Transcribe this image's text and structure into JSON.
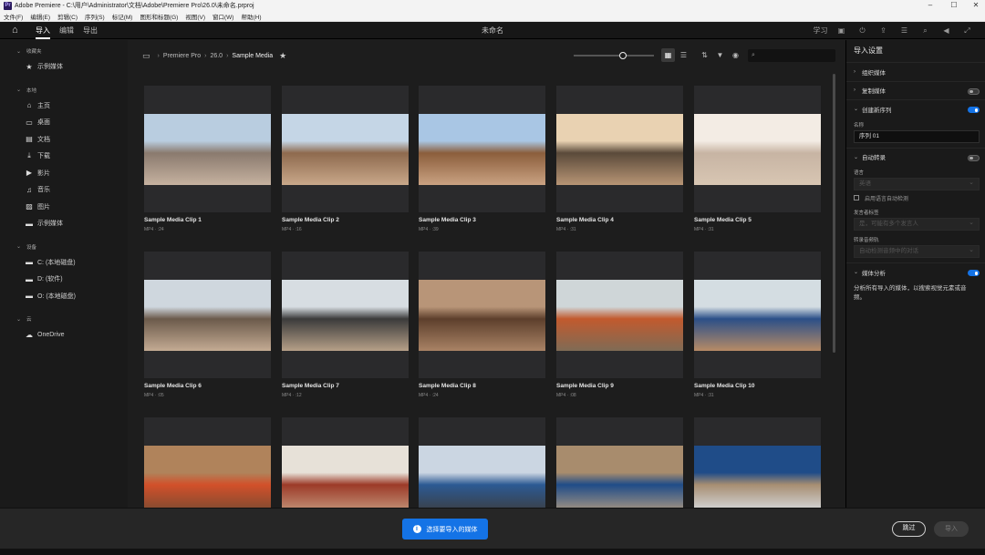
{
  "window": {
    "title": "Adobe Premiere - C:\\用户\\Administrator\\文档\\Adobe\\Premiere Pro\\26.0\\未命名.prproj",
    "icon_label": "Pr",
    "controls": [
      "–",
      "☐",
      "✕"
    ]
  },
  "menubar": [
    "文件(F)",
    "编辑(E)",
    "剪辑(C)",
    "序列(S)",
    "标记(M)",
    "图形和标题(G)",
    "视图(V)",
    "窗口(W)",
    "帮助(H)"
  ],
  "topnav": {
    "tabs": [
      "导入",
      "编辑",
      "导出"
    ],
    "active_tab": 0,
    "doc_title": "未命名",
    "right_icons": [
      "学习",
      "workspace-icon",
      "share-icon",
      "quick-export-icon",
      "panels-icon",
      "search-icon",
      "volume-icon",
      "fullscreen-icon"
    ],
    "learn_label": "学习"
  },
  "sidebar": {
    "sections": [
      {
        "title": "收藏夹",
        "items": [
          {
            "icon": "★",
            "label": "示例媒体"
          }
        ]
      },
      {
        "title": "本地",
        "items": [
          {
            "icon": "⌂",
            "label": "主页"
          },
          {
            "icon": "▭",
            "label": "桌面"
          },
          {
            "icon": "▤",
            "label": "文档"
          },
          {
            "icon": "⤓",
            "label": "下载"
          },
          {
            "icon": "▶",
            "label": "影片"
          },
          {
            "icon": "♫",
            "label": "音乐"
          },
          {
            "icon": "▨",
            "label": "图片"
          },
          {
            "icon": "▬",
            "label": "示例媒体"
          }
        ]
      },
      {
        "title": "设备",
        "items": [
          {
            "icon": "▬",
            "label": "C: (本地磁盘)"
          },
          {
            "icon": "▬",
            "label": "D: (软件)"
          },
          {
            "icon": "▬",
            "label": "O: (本地磁盘)"
          }
        ]
      },
      {
        "title": "云",
        "items": [
          {
            "icon": "☁",
            "label": "OneDrive"
          }
        ]
      }
    ]
  },
  "browser": {
    "breadcrumb": [
      "Premiere Pro",
      "26.0",
      "Sample Media"
    ],
    "search_placeholder": "",
    "zoom_level": 0.62,
    "clips": [
      {
        "name": "Sample Media Clip 1",
        "meta": "MP4 · :24",
        "colors": [
          "#b9cde0",
          "#8a7a6e",
          "#c6b2a0"
        ]
      },
      {
        "name": "Sample Media Clip 2",
        "meta": "MP4 · :16",
        "colors": [
          "#c5d6e6",
          "#8e6a4e",
          "#c9a88a"
        ]
      },
      {
        "name": "Sample Media Clip 3",
        "meta": "MP4 · :39",
        "colors": [
          "#a9c6e4",
          "#8b5e3c",
          "#caa282"
        ]
      },
      {
        "name": "Sample Media Clip 4",
        "meta": "MP4 · :31",
        "colors": [
          "#e9d2b2",
          "#5a4a3a",
          "#b89575"
        ]
      },
      {
        "name": "Sample Media Clip 5",
        "meta": "MP4 · :31",
        "colors": [
          "#f3ece4",
          "#c7b4a3",
          "#d8c6b3"
        ]
      },
      {
        "name": "Sample Media Clip 6",
        "meta": "MP4 · :05",
        "colors": [
          "#cfd7de",
          "#6b5a4b",
          "#c4ab93"
        ]
      },
      {
        "name": "Sample Media Clip 7",
        "meta": "MP4 · :12",
        "colors": [
          "#d7dde2",
          "#3b3b3b",
          "#b6a088"
        ]
      },
      {
        "name": "Sample Media Clip 8",
        "meta": "MP4 · :24",
        "colors": [
          "#b89578",
          "#5d3f2c",
          "#a98365"
        ]
      },
      {
        "name": "Sample Media Clip 9",
        "meta": "MP4 · :08",
        "colors": [
          "#cfd6d8",
          "#c25a2e",
          "#7f6b55"
        ]
      },
      {
        "name": "Sample Media Clip 10",
        "meta": "MP4 · :31",
        "colors": [
          "#d4dde2",
          "#2b4f88",
          "#b78b66"
        ]
      },
      {
        "name": "",
        "meta": "",
        "colors": [
          "#b0835b",
          "#d2502a",
          "#6d4a32"
        ]
      },
      {
        "name": "",
        "meta": "",
        "colors": [
          "#e7e1d8",
          "#9c3a28",
          "#caa488"
        ]
      },
      {
        "name": "",
        "meta": "",
        "colors": [
          "#cbd6e2",
          "#2c5a93",
          "#3e3a36"
        ]
      },
      {
        "name": "",
        "meta": "",
        "colors": [
          "#a88c6d",
          "#1f4c88",
          "#c1a480"
        ]
      },
      {
        "name": "",
        "meta": "",
        "colors": [
          "#1f4c88",
          "#a78e72",
          "#dfe8f1"
        ]
      }
    ]
  },
  "import_settings": {
    "title": "导入设置",
    "sections": {
      "organize": {
        "label": "组织媒体"
      },
      "copy": {
        "label": "复制媒体",
        "toggle": false
      },
      "new_sequence": {
        "label": "创建新序列",
        "toggle": true,
        "name_label": "名称",
        "name_value": "序列 01"
      },
      "auto_transcribe": {
        "label": "自动转录",
        "toggle": false,
        "language_label": "语言",
        "language_value": "英语",
        "auto_detect_label": "启用语言自动检测",
        "speaker_label": "发言者标签",
        "speaker_value": "是，可能有多个发言人",
        "transcribe_label": "转录音频轨",
        "transcribe_value": "自动检测音频中的对话"
      },
      "media_analysis": {
        "label": "媒体分析",
        "toggle": true,
        "description": "分析所有导入的媒体，以搜索视觉元素或音频。"
      }
    }
  },
  "footer": {
    "primary_label": "选择要导入的媒体",
    "skip_label": "跳过",
    "import_label": "导入"
  }
}
